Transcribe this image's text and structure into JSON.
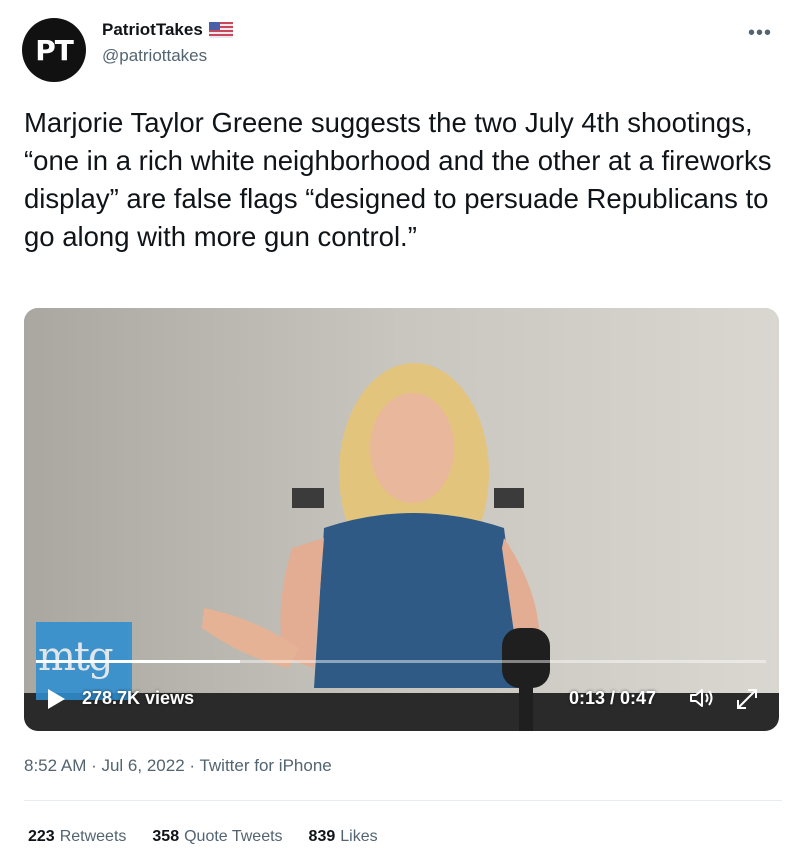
{
  "author": {
    "avatar_text": "PT",
    "display_name": "PatriotTakes",
    "flag_icon": "us-flag-icon",
    "handle": "@patriottakes"
  },
  "more_icon": "more-options-icon",
  "tweet": {
    "text": "Marjorie Taylor Greene suggests the two July 4th shootings, “one in a rich white neighborhood and the other at a fireworks display” are false flags “designed to persuade Republicans to go along with more gun control.”"
  },
  "video": {
    "logo_text": "mtg",
    "views": "278.7K views",
    "time": "0:13 / 0:47",
    "progress": 0.28,
    "icons": [
      "play-icon",
      "volume-icon",
      "fullscreen-icon"
    ]
  },
  "meta": {
    "timestamp": "8:52 AM · Jul 6, 2022 · Twitter for iPhone"
  },
  "stats": [
    {
      "count": "223",
      "label": "Retweets"
    },
    {
      "count": "358",
      "label": "Quote Tweets"
    },
    {
      "count": "839",
      "label": "Likes"
    }
  ],
  "colors": {
    "text": "#0f1419",
    "secondary": "#536471",
    "divider": "#e6ecf0",
    "logo_blue": "#2f8fd1"
  }
}
